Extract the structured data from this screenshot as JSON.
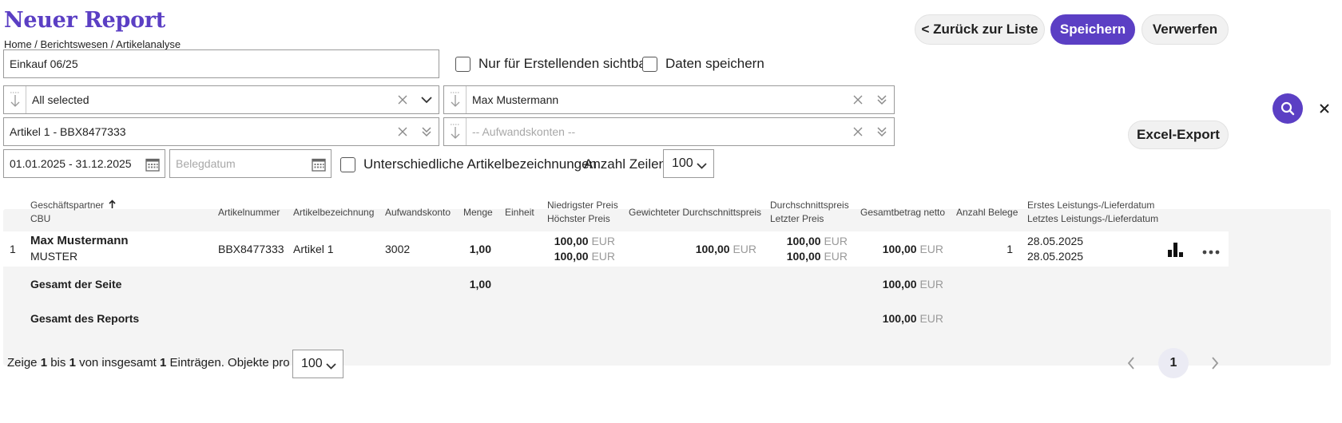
{
  "header": {
    "title": "Neuer Report",
    "breadcrumb": "Home / Berichtswesen / Artikelanalyse"
  },
  "actions": {
    "back_label": "< Zurück zur Liste",
    "save_label": "Speichern",
    "discard_label": "Verwerfen",
    "excel_label": "Excel-Export"
  },
  "form": {
    "report_name": "Einkauf 06/25",
    "only_creator_label": "Nur für Erstellenden sichtbar",
    "save_data_label": "Daten speichern",
    "filter_all_selected": "All selected",
    "filter_partner": "Max Mustermann",
    "filter_article": "Artikel 1 - BBX8477333",
    "filter_accounts_placeholder": "-- Aufwandskonten --",
    "date_range": "01.01.2025 - 31.12.2025",
    "receipt_date_placeholder": "Belegdatum",
    "different_names_label": "Unterschiedliche Artikelbezeichnungen",
    "rows_label": "Anzahl Zeilen:",
    "rows_value": "100"
  },
  "table": {
    "headers": {
      "partner": "Geschäftspartner",
      "partner_sub": "CBU",
      "article_no": "Artikelnummer",
      "article_name": "Artikelbezeichnung",
      "account": "Aufwandskonto",
      "qty": "Menge",
      "unit": "Einheit",
      "price_low": "Niedrigster Preis",
      "price_high": "Höchster Preis",
      "weighted_avg": "Gewichteter Durchschnittspreis",
      "avg_price": "Durchschnittspreis",
      "last_price": "Letzter Preis",
      "total_net": "Gesamtbetrag netto",
      "receipt_count": "Anzahl Belege",
      "first_date": "Erstes Leistungs-/Lieferdatum",
      "last_date": "Letztes Leistungs-/Lieferdatum"
    },
    "row": {
      "index": "1",
      "partner": "Max Mustermann",
      "cbu": "MUSTER",
      "article_no": "BBX8477333",
      "article_name": "Artikel 1",
      "account": "3002",
      "qty": "1,00",
      "price_low": "100,00",
      "price_high": "100,00",
      "weighted_avg": "100,00",
      "avg_price": "100,00",
      "last_price": "100,00",
      "total_net": "100,00",
      "receipt_count": "1",
      "first_date": "28.05.2025",
      "last_date": "28.05.2025"
    },
    "currency": "EUR",
    "page_total_label": "Gesamt der Seite",
    "page_total_qty": "1,00",
    "page_total_net": "100,00",
    "report_total_label": "Gesamt des Reports",
    "report_total_net": "100,00"
  },
  "footer": {
    "prefix": "Zeige ",
    "from": "1",
    "mid1": " bis ",
    "to": "1",
    "mid2": " von insgesamt ",
    "total": "1",
    "suffix": " Einträgen. Objekte pro Seite:",
    "per_page": "100",
    "current_page": "1"
  },
  "colors": {
    "accent": "#5b3fc4"
  }
}
